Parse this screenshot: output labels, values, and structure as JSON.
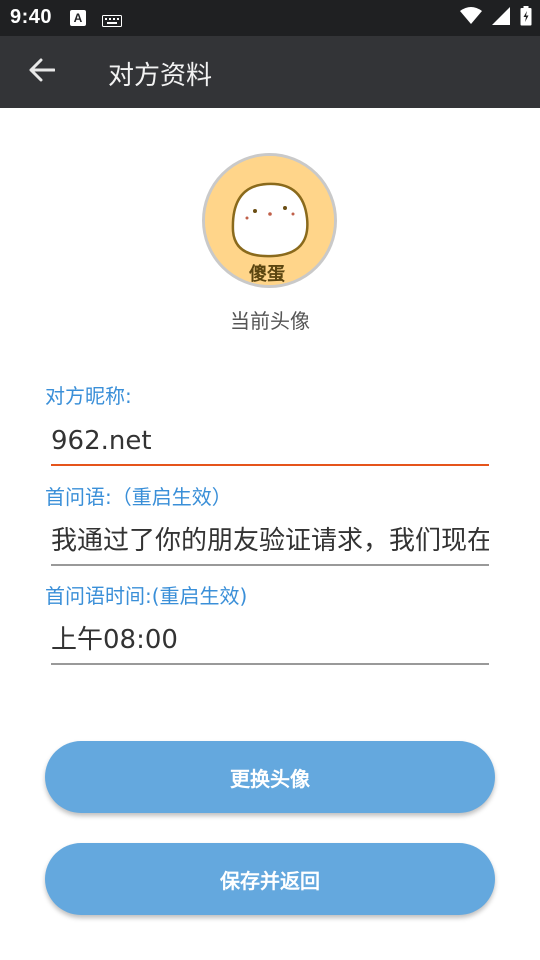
{
  "status_bar": {
    "time": "9:40",
    "notification_icon_letter": "A",
    "icons": [
      "a-notification-icon",
      "keyboard-icon",
      "wifi-icon",
      "signal-icon",
      "battery-charging-icon"
    ]
  },
  "app_bar": {
    "title": "对方资料",
    "back_icon": "arrow-left-icon"
  },
  "avatar": {
    "label": "当前头像",
    "image_text": "傻蛋"
  },
  "form": {
    "nickname": {
      "label": "对方昵称:",
      "value": "962.net"
    },
    "greeting": {
      "label": "首问语:（重启生效）",
      "value": "我通过了你的朋友验证请求，我们现在可以开始聊天了"
    },
    "greeting_time": {
      "label": "首问语时间:(重启生效)",
      "value": "上午08:00"
    }
  },
  "buttons": {
    "change_avatar": "更换头像",
    "save_return": "保存并返回"
  },
  "colors": {
    "status_bar_bg": "#1f2022",
    "app_bar_bg": "#333437",
    "label_blue": "#3a8fd8",
    "active_underline": "#e5541b",
    "button_bg": "#64a8de",
    "avatar_bg": "#ffd58a"
  }
}
